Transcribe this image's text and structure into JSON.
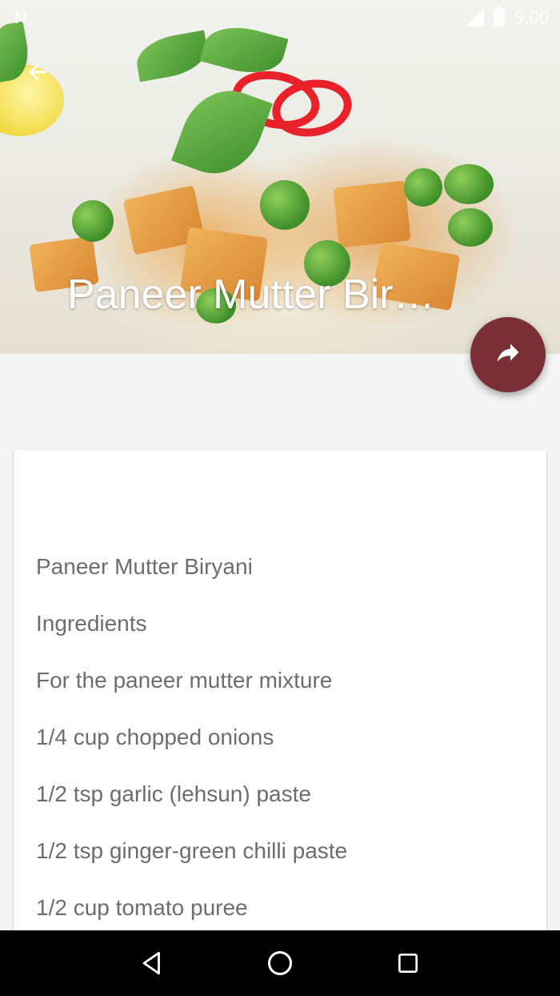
{
  "status_bar": {
    "time": "9:00",
    "notification_glyph": "N"
  },
  "header": {
    "title": "Paneer Mutter Biryani"
  },
  "icons": {
    "back": "arrow-left-icon",
    "share": "share-icon",
    "nav_back": "triangle-back-icon",
    "nav_home": "circle-home-icon",
    "nav_recents": "square-recents-icon"
  },
  "colors": {
    "fab": "#7a2f37",
    "text": "#6d6d6d",
    "nav_bar": "#000000"
  },
  "recipe": {
    "lines": [
      "Paneer Mutter Biryani",
      "Ingredients",
      "For the paneer mutter mixture",
      "1/4 cup chopped onions",
      "1/2 tsp garlic (lehsun) paste",
      "1/2 tsp ginger-green chilli paste",
      "1/2 cup tomato puree"
    ]
  }
}
